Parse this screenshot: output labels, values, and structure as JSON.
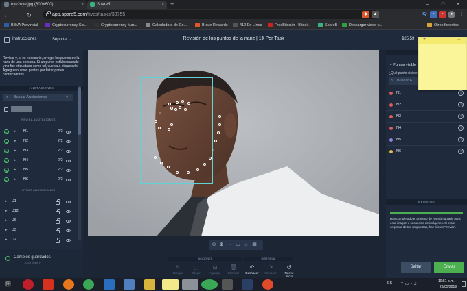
{
  "browser": {
    "tabs": [
      {
        "title": "eye2eye.jpg (600×600)",
        "active": false
      },
      {
        "title": "Spare5",
        "active": true
      },
      {
        "title": "",
        "active": false
      }
    ],
    "url_host": "app.spare5.com",
    "url_path": "/fives/tasks/38755",
    "bookmarks": [
      "BBVA Provincial",
      "Cryptocurrency Scr...",
      "Cryptocurrency Mar...",
      "Calculadora de Co...",
      "Brave Rewards",
      "412 En Línea",
      "FreeBitco.in - Bitcoi...",
      "Spare5",
      "Descargar video y...",
      "Otros favoritos"
    ]
  },
  "header": {
    "nav_instructions": "Instrucciones",
    "nav_support": "Soporte",
    "title": "Revisión de los puntos de la nariz | 1¢ Per Task",
    "earnings": "$25.59"
  },
  "left": {
    "instructions": "Revisar y, si es necesario, arregle los puntos de la nariz de una persona. Si un punto está bloqueado y no fue etiquetado como tal, vuelva a etiquetarlo. Agregue nuevos puntos por faltar partes confiscadores.",
    "annotations_header": "ANOTACIONES",
    "search_placeholder": "Buscar Anotaciones",
    "review_section": "REVISA ANOTACIONES",
    "review_items": [
      {
        "label": "N1",
        "count": "2/2"
      },
      {
        "label": "N2",
        "count": "2/2"
      },
      {
        "label": "N3",
        "count": "2/2"
      },
      {
        "label": "N4",
        "count": "2/2"
      },
      {
        "label": "N5",
        "count": "2/2"
      },
      {
        "label": "N6",
        "count": "2/2"
      }
    ],
    "other_section": "OTRAS ANOTACIONES",
    "other_items": [
      {
        "label": "J1"
      },
      {
        "label": "J12"
      },
      {
        "label": "J6"
      },
      {
        "label": "J3"
      },
      {
        "label": "J2"
      }
    ],
    "saved_label": "Cambios guardados",
    "saved_time": "10:49 2019, H"
  },
  "toolbar": {
    "actions_label": "ACCIONES",
    "history_label": "HISTORIAL",
    "tools": [
      {
        "label": "Dibujar",
        "icon": "draw-icon",
        "active": false
      },
      {
        "label": "Elegir",
        "icon": "pick-icon",
        "active": false
      },
      {
        "label": "Agrupar",
        "icon": "group-icon",
        "active": false
      },
      {
        "label": "Eliminar",
        "icon": "trash-icon",
        "active": false
      },
      {
        "label": "Deshacer",
        "icon": "undo-icon",
        "active": true
      },
      {
        "label": "Rehacer",
        "icon": "redo-icon",
        "active": false
      },
      {
        "label": "Nuevo inicio",
        "icon": "restart-icon",
        "active": true
      }
    ]
  },
  "right": {
    "points_visible_label": "Puntos visible",
    "question": "¿Qué punto visible",
    "search_placeholder": "Buscar E",
    "points": [
      {
        "label": "N1",
        "color": "#e15b5b"
      },
      {
        "label": "N2",
        "color": "#e15b5b"
      },
      {
        "label": "N3",
        "color": "#e15b5b"
      },
      {
        "label": "N4",
        "color": "#e15b5b"
      },
      {
        "label": "N5",
        "color": "#8f86e6"
      },
      {
        "label": "N6",
        "color": "#e6b84a"
      }
    ],
    "review_header": "REVISIÓN",
    "review_message": "Has completado el proceso de revisión guiado para esta imagen o secuencia de imágenes. Si estás seguro/a de tus respuestas, haz clic en \"Enviar\".",
    "skip_label": "Saltar",
    "submit_label": "Enviar"
  },
  "sticky_note": {
    "plus": "+",
    "dots": "..."
  },
  "taskbar": {
    "lang": "ES",
    "time": "10:51 p.m.",
    "date": "23/05/2019"
  }
}
